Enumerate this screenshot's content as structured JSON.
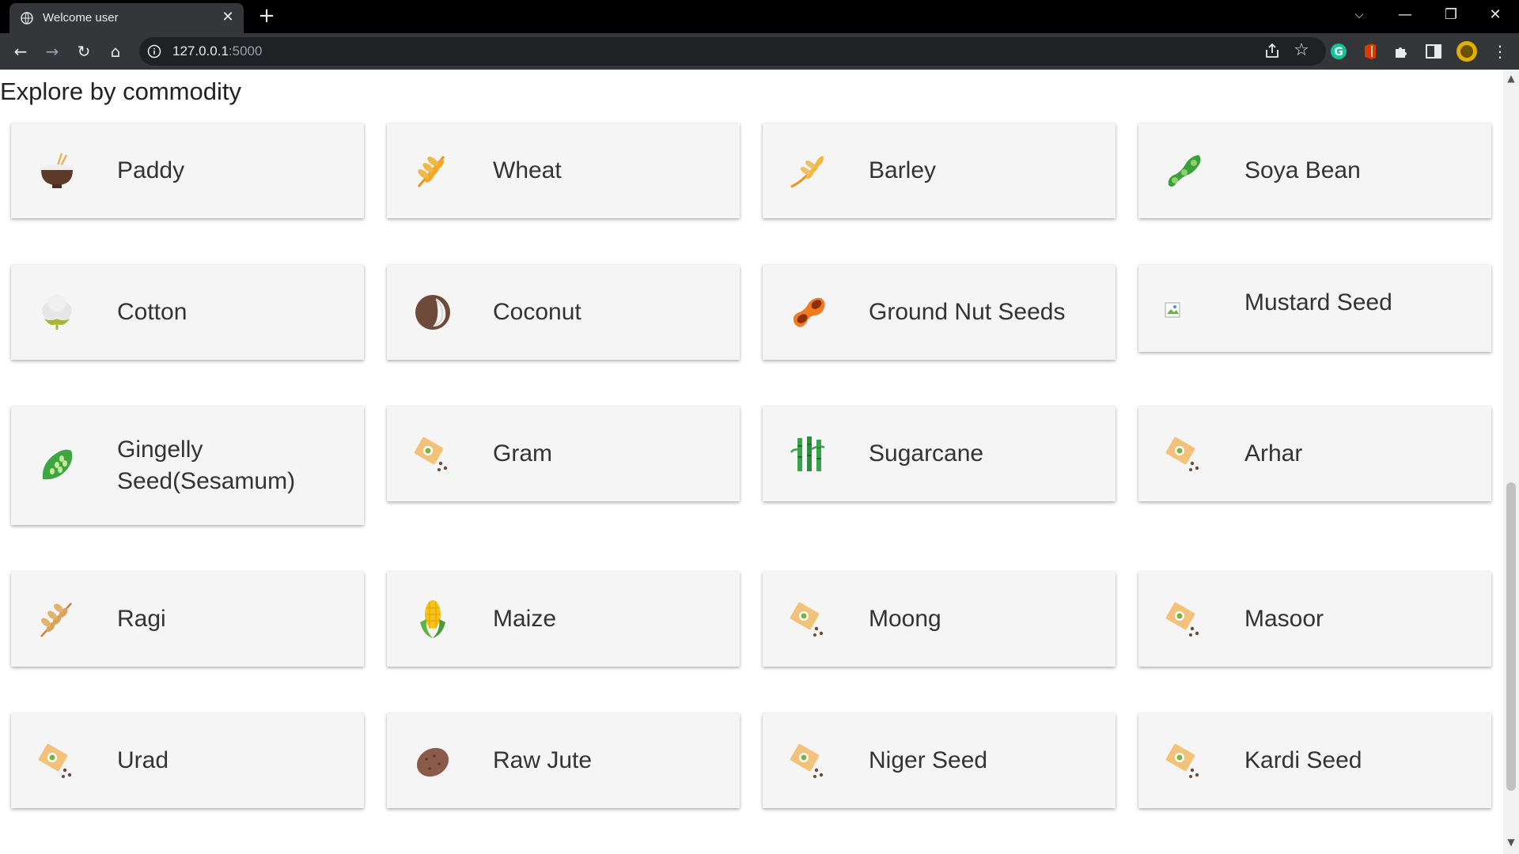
{
  "browser": {
    "tab_title": "Welcome user",
    "url_host": "127.0.0.1",
    "url_port": ":5000"
  },
  "page": {
    "heading": "Explore by commodity"
  },
  "commodities": [
    {
      "label": "Paddy",
      "icon": "rice-bowl-icon"
    },
    {
      "label": "Wheat",
      "icon": "wheat-icon"
    },
    {
      "label": "Barley",
      "icon": "barley-icon"
    },
    {
      "label": "Soya Bean",
      "icon": "soybean-icon"
    },
    {
      "label": "Cotton",
      "icon": "cotton-icon"
    },
    {
      "label": "Coconut",
      "icon": "coconut-icon"
    },
    {
      "label": "Ground Nut Seeds",
      "icon": "peanut-icon"
    },
    {
      "label": "Mustard Seed",
      "icon": "broken-image-icon"
    },
    {
      "label": "Gingelly Seed(Sesamum)",
      "icon": "sesame-icon"
    },
    {
      "label": "Gram",
      "icon": "seed-packet-icon"
    },
    {
      "label": "Sugarcane",
      "icon": "sugarcane-icon"
    },
    {
      "label": "Arhar",
      "icon": "seed-packet-icon"
    },
    {
      "label": "Ragi",
      "icon": "ragi-icon"
    },
    {
      "label": "Maize",
      "icon": "corn-icon"
    },
    {
      "label": "Moong",
      "icon": "seed-packet-icon"
    },
    {
      "label": "Masoor",
      "icon": "seed-packet-icon"
    },
    {
      "label": "Urad",
      "icon": "seed-packet-icon"
    },
    {
      "label": "Raw Jute",
      "icon": "jute-icon"
    },
    {
      "label": "Niger Seed",
      "icon": "seed-packet-icon"
    },
    {
      "label": "Kardi Seed",
      "icon": "seed-packet-icon"
    }
  ]
}
